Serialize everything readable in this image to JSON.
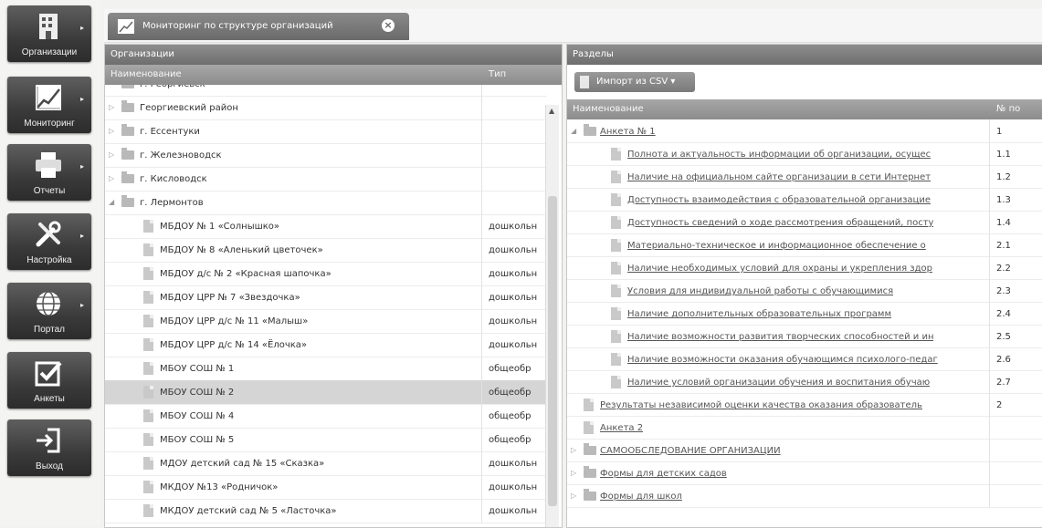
{
  "sidebar": {
    "items": [
      {
        "label": "Организации",
        "icon": "building-icon"
      },
      {
        "label": "Мониторинг",
        "icon": "chart-icon"
      },
      {
        "label": "Отчеты",
        "icon": "printer-icon"
      },
      {
        "label": "Настройка",
        "icon": "tools-icon"
      },
      {
        "label": "Портал",
        "icon": "globe-icon"
      },
      {
        "label": "Анкеты",
        "icon": "checkbox-icon"
      },
      {
        "label": "Выход",
        "icon": "exit-icon"
      }
    ]
  },
  "tab": {
    "label": "Мониторинг по структуре организаций",
    "close": "×"
  },
  "left": {
    "title": "Организации",
    "col_name": "Наименование",
    "col_type": "Тип",
    "rows": [
      {
        "name": "г. Георгиевск",
        "type": ""
      },
      {
        "name": "Георгиевский район",
        "type": ""
      },
      {
        "name": "г. Ессентуки",
        "type": ""
      },
      {
        "name": "г. Железноводск",
        "type": ""
      },
      {
        "name": "г. Кисловодск",
        "type": ""
      },
      {
        "name": "г. Лермонтов",
        "type": ""
      },
      {
        "name": "МБДОУ № 1 «Солнышко»",
        "type": "дошкольн"
      },
      {
        "name": "МБДОУ № 8 «Аленький цветочек»",
        "type": "дошкольн"
      },
      {
        "name": "МБДОУ д/с № 2 «Красная шапочка»",
        "type": "дошкольн"
      },
      {
        "name": "МБДОУ ЦРР № 7 «Звездочка»",
        "type": "дошкольн"
      },
      {
        "name": "МБДОУ ЦРР д/с № 11 «Малыш»",
        "type": "дошкольн"
      },
      {
        "name": "МБДОУ ЦРР д/с № 14 «Ёлочка»",
        "type": "дошкольн"
      },
      {
        "name": "МБОУ СОШ № 1",
        "type": "общеобр"
      },
      {
        "name": "МБОУ СОШ № 2",
        "type": "общеобр"
      },
      {
        "name": "МБОУ СОШ № 4",
        "type": "общеобр"
      },
      {
        "name": "МБОУ СОШ № 5",
        "type": "общеобр"
      },
      {
        "name": "МДОУ детский сад № 15 «Сказка»",
        "type": "дошкольн"
      },
      {
        "name": "МКДОУ №13 «Родничок»",
        "type": "дошкольн"
      },
      {
        "name": "МКДОУ детский сад № 5 «Ласточка»",
        "type": "дошкольн"
      }
    ]
  },
  "right": {
    "title": "Разделы",
    "import_label": "Импорт из CSV",
    "col_name": "Наименование",
    "col_num": "№ по",
    "rows": [
      {
        "name": "Анкета № 1",
        "num": "1"
      },
      {
        "name": "Полнота и актуальность информации об организации, осущес",
        "num": "1.1"
      },
      {
        "name": "Наличие на официальном сайте организации в сети Интернет",
        "num": "1.2"
      },
      {
        "name": "Доступность взаимодействия с образовательной организацие",
        "num": "1.3"
      },
      {
        "name": "Доступность сведений о ходе рассмотрения обращений, посту",
        "num": "1.4"
      },
      {
        "name": "Материально-техническое и информационное обеспечение о",
        "num": "2.1"
      },
      {
        "name": "Наличие необходимых условий для охраны и укрепления здор",
        "num": "2.2"
      },
      {
        "name": "Условия для индивидуальной работы с обучающимися",
        "num": "2.3"
      },
      {
        "name": "Наличие дополнительных образовательных программ",
        "num": "2.4"
      },
      {
        "name": "Наличие возможности развития творческих способностей и ин",
        "num": "2.5"
      },
      {
        "name": "Наличие возможности оказания обучающимся психолого-педаг",
        "num": "2.6"
      },
      {
        "name": "Наличие условий организации обучения и воспитания обучаю",
        "num": "2.7"
      },
      {
        "name": "Результаты независимой оценки качества оказания образователь",
        "num": "2"
      },
      {
        "name": "Анкета 2",
        "num": ""
      },
      {
        "name": "САМООБСЛЕДОВАНИЕ ОРГАНИЗАЦИИ",
        "num": ""
      },
      {
        "name": "Формы для детских садов",
        "num": ""
      },
      {
        "name": "Формы для школ",
        "num": ""
      }
    ]
  }
}
